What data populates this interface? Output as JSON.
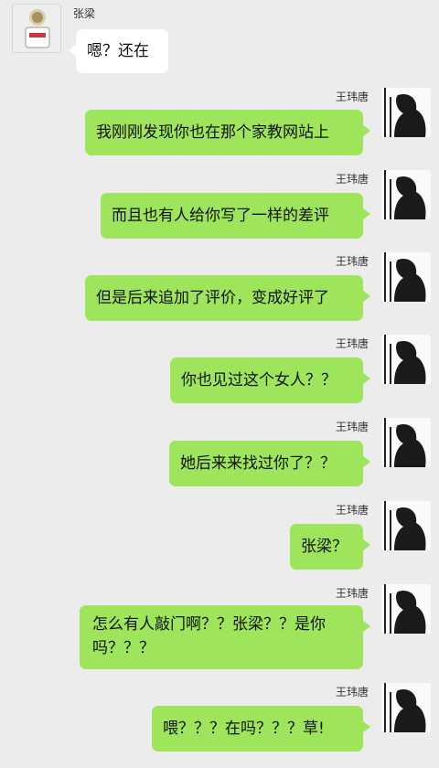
{
  "contact": {
    "name": "张梁",
    "avatar_icon": "person-avatar-icon"
  },
  "self": {
    "name": "王玮唐",
    "avatar_icon": "silhouette-avatar-icon"
  },
  "colors": {
    "background": "#ececec",
    "sent_bubble": "#9ee55c",
    "received_bubble": "#ffffff"
  },
  "messages": [
    {
      "sender": "张梁",
      "text": "嗯？还在"
    },
    {
      "sender": "王玮唐",
      "text": "我刚刚发现你也在那个家教网站上"
    },
    {
      "sender": "王玮唐",
      "text": "而且也有人给你写了一样的差评"
    },
    {
      "sender": "王玮唐",
      "text": "但是后来追加了评价，变成好评了"
    },
    {
      "sender": "王玮唐",
      "text": "你也见过这个女人？？"
    },
    {
      "sender": "王玮唐",
      "text": "她后来来找过你了？？"
    },
    {
      "sender": "王玮唐",
      "text": "张梁？"
    },
    {
      "sender": "王玮唐",
      "text": "怎么有人敲门啊？？张梁？？是你吗？？？"
    },
    {
      "sender": "王玮唐",
      "text": "喂？？？在吗？？？草!"
    }
  ]
}
